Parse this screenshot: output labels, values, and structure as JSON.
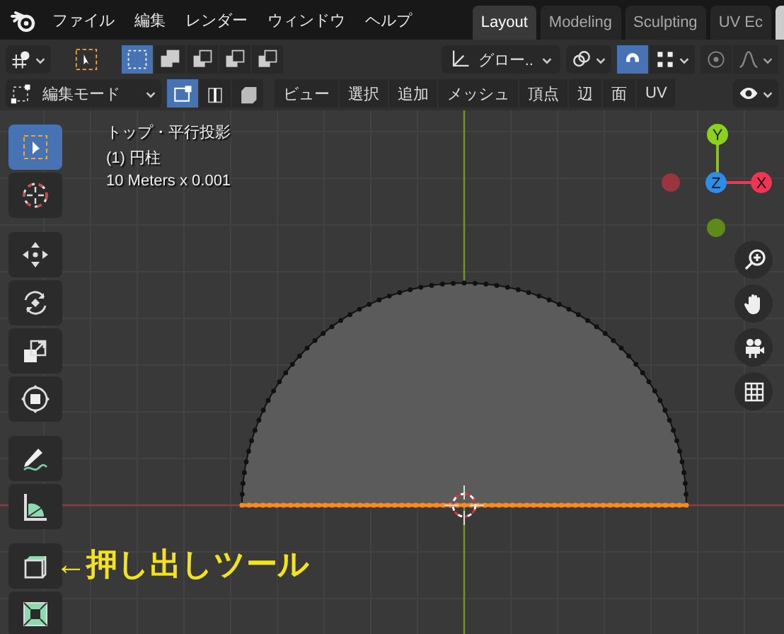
{
  "menu_bar": {
    "items": [
      "ファイル",
      "編集",
      "レンダー",
      "ウィンドウ",
      "ヘルプ"
    ]
  },
  "workspace_tabs": [
    {
      "label": "Layout",
      "selected": true
    },
    {
      "label": "Modeling",
      "selected": false
    },
    {
      "label": "Sculpting",
      "selected": false
    },
    {
      "label": "UV Ec",
      "selected": false
    }
  ],
  "tool_header": {
    "orientation": "グロー..",
    "snap": true,
    "proportional_edit": false
  },
  "edit_header": {
    "mode": "編集モード",
    "select_modes": [
      {
        "kind": "vertex",
        "selected": true
      },
      {
        "kind": "edge",
        "selected": false
      },
      {
        "kind": "face",
        "selected": false
      }
    ],
    "menus": [
      "ビュー",
      "選択",
      "追加",
      "メッシュ",
      "頂点",
      "辺",
      "面",
      "UV"
    ]
  },
  "viewport": {
    "info": [
      "トップ・平行投影",
      "(1) 円柱",
      "10 Meters x 0.001"
    ],
    "axes": {
      "y": "Y",
      "z": "Z",
      "x": "X"
    },
    "annotation": "←押し出しツール",
    "tools": [
      {
        "kind": "select",
        "selected": true
      },
      {
        "kind": "cursor",
        "selected": false
      },
      {
        "kind": "move",
        "selected": false
      },
      {
        "kind": "rotate",
        "selected": false
      },
      {
        "kind": "scale",
        "selected": false
      },
      {
        "kind": "transform",
        "selected": false
      },
      {
        "kind": "annotate",
        "selected": false
      },
      {
        "kind": "measure",
        "selected": false
      },
      {
        "kind": "extrude",
        "selected": false
      },
      {
        "kind": "inset",
        "selected": false
      }
    ]
  }
}
